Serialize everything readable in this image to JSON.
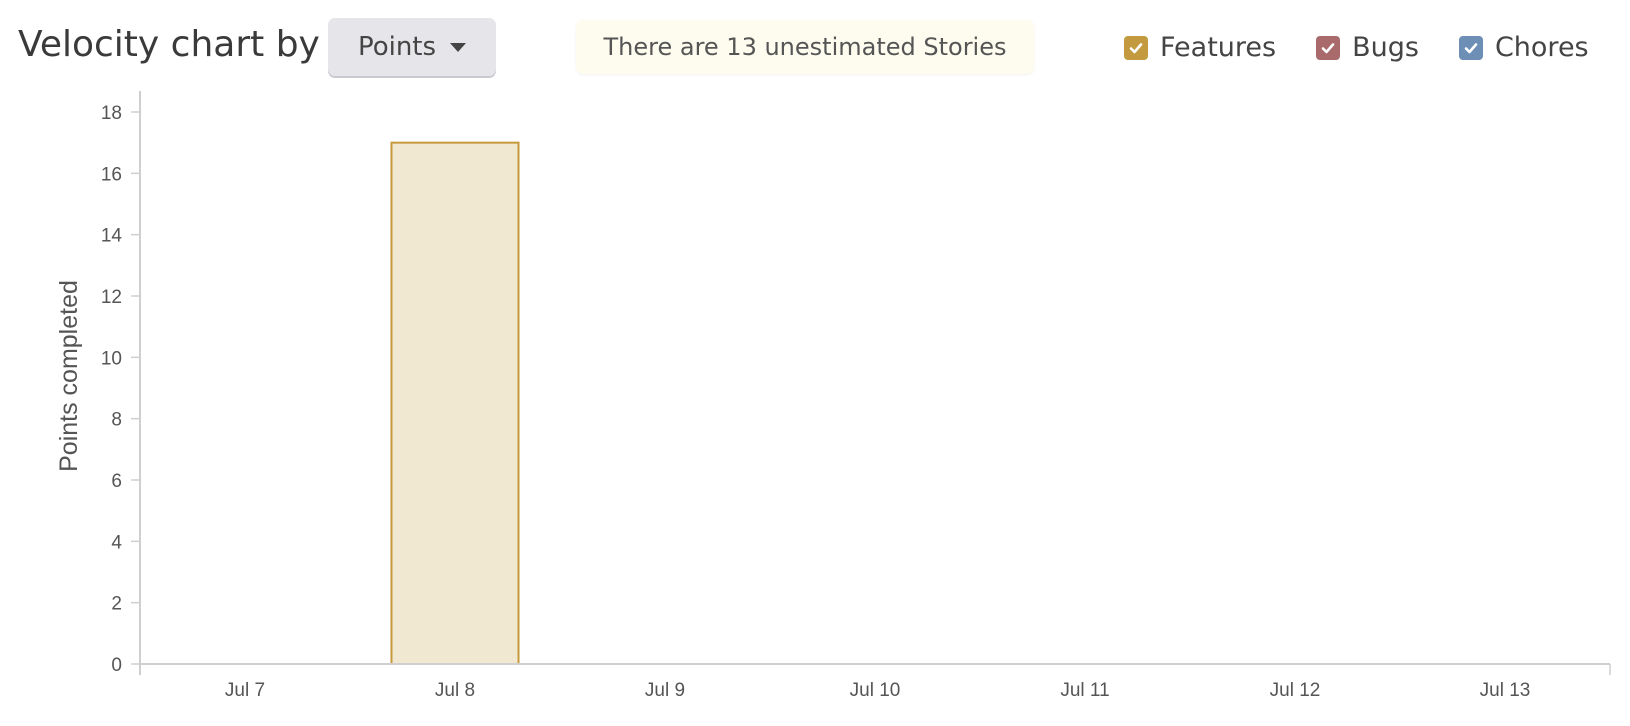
{
  "header": {
    "title": "Velocity chart by",
    "dropdown": {
      "selected": "Points"
    },
    "notice": "There are 13 unestimated Stories",
    "legend": [
      {
        "label": "Features",
        "color": "#c39a3e",
        "checked": true
      },
      {
        "label": "Bugs",
        "color": "#a86a6a",
        "checked": true
      },
      {
        "label": "Chores",
        "color": "#6e8fb5",
        "checked": true
      }
    ]
  },
  "chart_data": {
    "type": "bar",
    "ylabel": "Points completed",
    "xlabel": "",
    "ylim": [
      0,
      18
    ],
    "yticks": [
      0,
      2,
      4,
      6,
      8,
      10,
      12,
      14,
      16,
      18
    ],
    "categories": [
      "Jul 7",
      "Jul 8",
      "Jul 9",
      "Jul 10",
      "Jul 11",
      "Jul 12",
      "Jul 13"
    ],
    "series": [
      {
        "name": "Features",
        "values": [
          0,
          17,
          0,
          0,
          0,
          0,
          0
        ],
        "fill": "#f1e8d2",
        "stroke": "#c69a3c"
      }
    ],
    "grid": false
  }
}
